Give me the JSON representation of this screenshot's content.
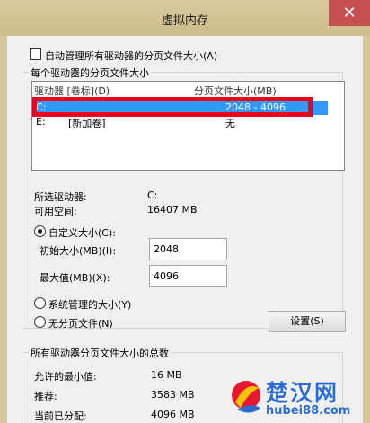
{
  "window": {
    "title": "虚拟内存",
    "close_glyph": "✕"
  },
  "auto_manage": {
    "label": "自动管理所有驱动器的分页文件大小(A)",
    "checked": false
  },
  "per_drive_group": {
    "title": "每个驱动器的分页文件大小",
    "columns": {
      "drive": "驱动器 [卷标](D)",
      "size": "分页文件大小(MB)"
    },
    "rows": [
      {
        "drive": "C:",
        "label": "",
        "size": "2048 - 4096",
        "selected": true
      },
      {
        "drive": "E:",
        "label": "[新加卷]",
        "size": "无",
        "selected": false
      }
    ]
  },
  "selected_drive": {
    "label": "所选驱动器:",
    "value": "C:"
  },
  "free_space": {
    "label": "可用空间:",
    "value": "16407 MB"
  },
  "options": {
    "custom": {
      "label": "自定义大小(C):",
      "checked": true
    },
    "initial": {
      "label": "初始大小(MB)(I):",
      "value": "2048"
    },
    "max": {
      "label": "最大值(MB)(X):",
      "value": "4096"
    },
    "system_managed": {
      "label": "系统管理的大小(Y)",
      "checked": false
    },
    "no_paging": {
      "label": "无分页文件(N)",
      "checked": false
    },
    "set_button": "设置(S)"
  },
  "totals_group": {
    "title": "所有驱动器分页文件大小的总数",
    "min_allowed": {
      "label": "允许的最小值:",
      "value": "16 MB"
    },
    "recommended": {
      "label": "推荐:",
      "value": "3583 MB"
    },
    "currently_allocated": {
      "label": "当前已分配:",
      "value": "4096 MB"
    }
  },
  "watermark": {
    "text": "楚汉网",
    "url": "hubei88.com"
  },
  "colors": {
    "selection": "#3399ff",
    "highlight": "#e8001c",
    "close": "#c75050",
    "watermark": "#2a6bd6"
  }
}
